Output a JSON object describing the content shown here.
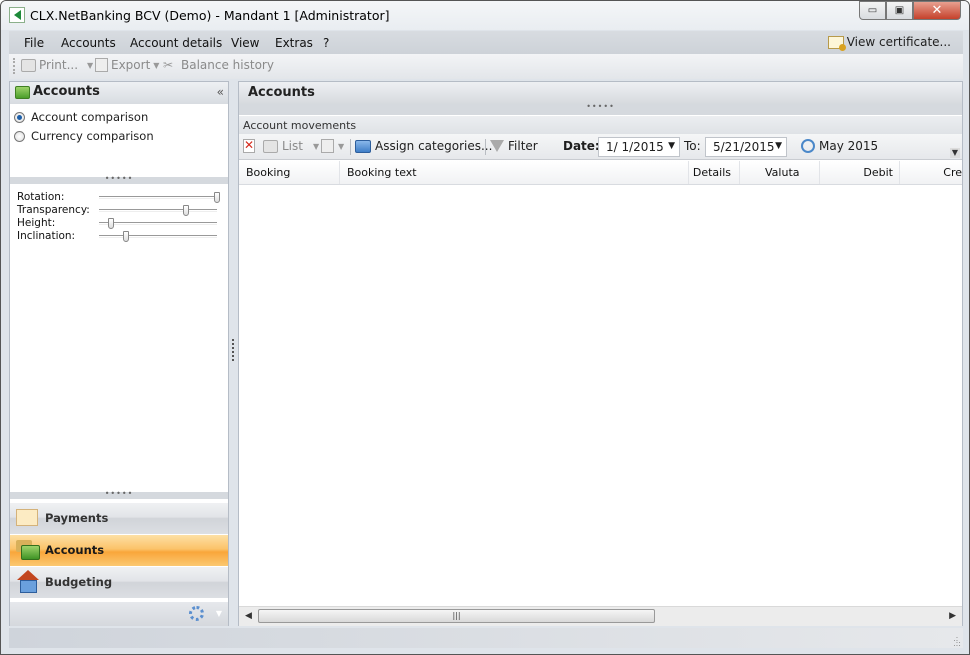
{
  "window": {
    "title": "CLX.NetBanking BCV (Demo) - Mandant 1 [Administrator]",
    "controls": {
      "minimize": "▭",
      "maximize": "▣",
      "close": "✕"
    }
  },
  "menubar": {
    "items": [
      "File",
      "Accounts",
      "Account details",
      "View",
      "Extras",
      "?"
    ],
    "view_certificate": "View certificate..."
  },
  "toolbar": {
    "print": "Print...",
    "export": "Export",
    "balance_history": "Balance history"
  },
  "left_panel": {
    "title": "Accounts",
    "collapse_glyph": "«",
    "radio_options": [
      {
        "label": "Account comparison",
        "selected": true
      },
      {
        "label": "Currency comparison",
        "selected": false
      }
    ],
    "splitter_glyph": "•••••",
    "sliders": [
      {
        "label": "Rotation:",
        "value_fraction": 1.0
      },
      {
        "label": "Transparency:",
        "value_fraction": 0.74
      },
      {
        "label": "Height:",
        "value_fraction": 0.1
      },
      {
        "label": "Inclination:",
        "value_fraction": 0.23
      }
    ],
    "nav": {
      "items": [
        {
          "label": "Payments",
          "icon": "payments-icon",
          "active": false
        },
        {
          "label": "Accounts",
          "icon": "accounts-icon",
          "active": true
        },
        {
          "label": "Budgeting",
          "icon": "budgeting-icon",
          "active": false
        }
      ],
      "footer_caret": "▼"
    }
  },
  "main_panel": {
    "title": "Accounts",
    "splitter_glyph": "•••••",
    "section_title": "Account movements",
    "toolbar": {
      "list": "List",
      "assign_categories": "Assign categories...",
      "filter": "Filter",
      "date_label": "Date:",
      "date_from": "1/ 1/2015",
      "to_label": "To:",
      "date_to": "5/21/2015",
      "period": "May 2015",
      "dropdown_arrow": "▼"
    },
    "columns": [
      "Booking",
      "Booking text",
      "Details",
      "Valuta",
      "Debit",
      "Cre"
    ],
    "rows": [],
    "scroll": {
      "left": "◀",
      "right": "▶",
      "thumb_grip": "|||"
    }
  },
  "colors": {
    "active_nav": "#f9a63a",
    "accent_blue": "#1c5ea8",
    "close_button": "#c5412b"
  }
}
